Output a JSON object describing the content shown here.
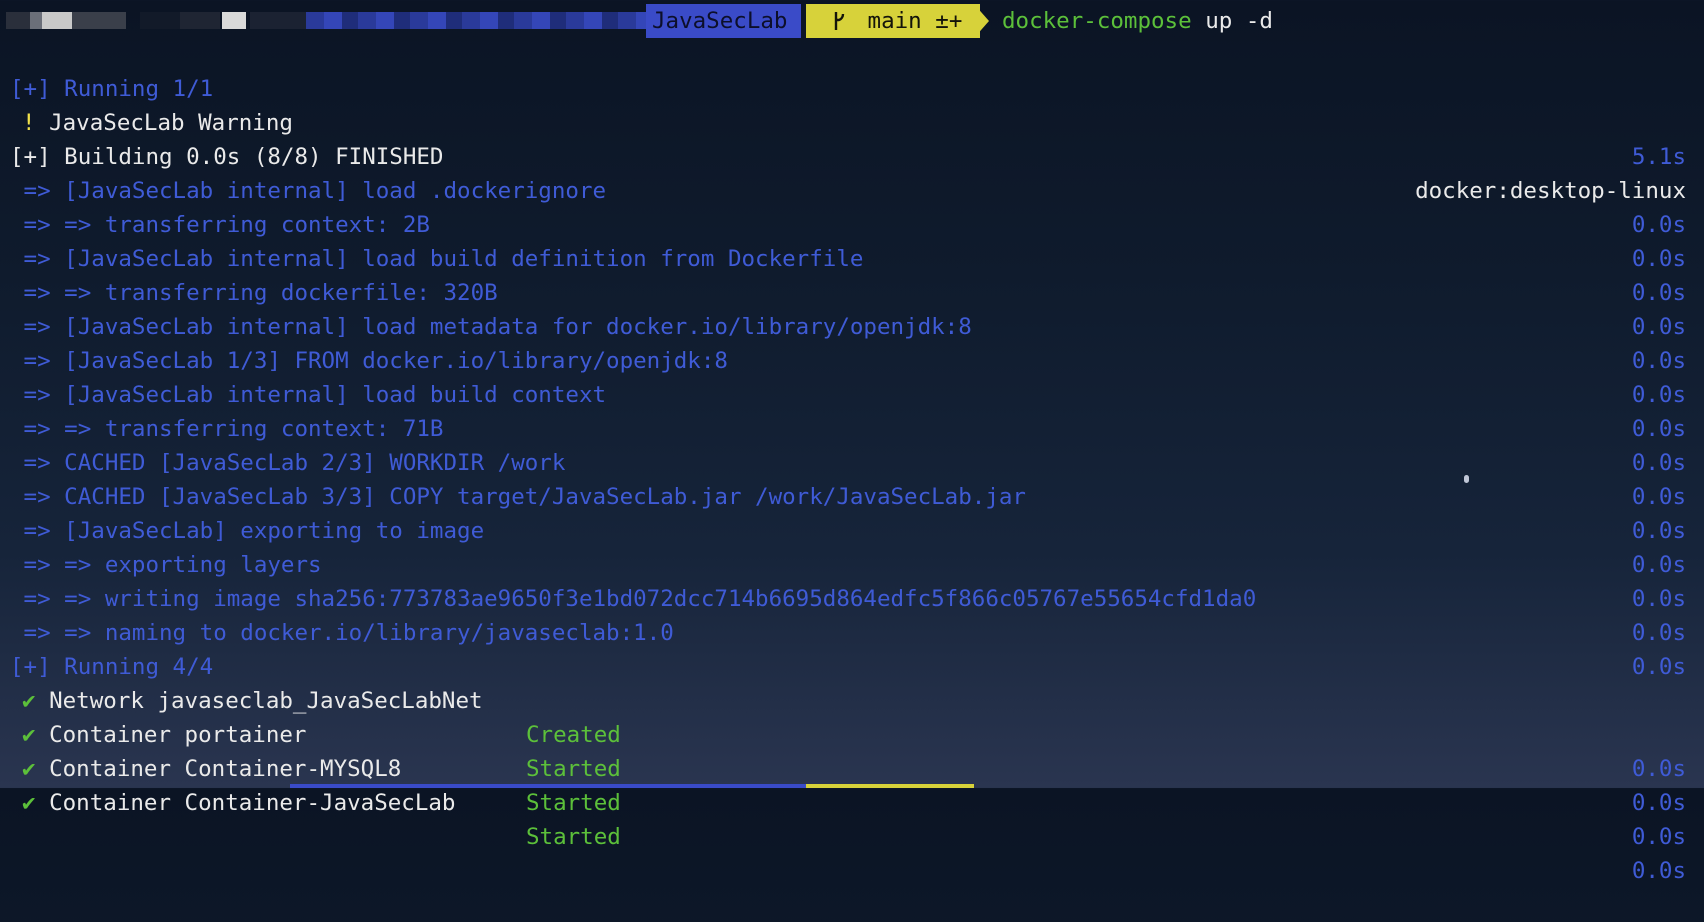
{
  "prompt": {
    "dir": "JavaSecLab",
    "branch_icon": "git-branch-icon",
    "branch": "main ±+",
    "command": "docker-compose",
    "args": " up -d"
  },
  "lines": [
    {
      "left": "[+] Running 1/1",
      "right": ""
    },
    {
      "marker": "!",
      "left": " JavaSecLab Warning",
      "right": "5.1s"
    },
    {
      "left": "[+] Building 0.0s (8/8) FINISHED",
      "right": "docker:desktop-linux"
    },
    {
      "left": " => [JavaSecLab internal] load .dockerignore",
      "right": "0.0s"
    },
    {
      "left": " => => transferring context: 2B",
      "right": "0.0s"
    },
    {
      "left": " => [JavaSecLab internal] load build definition from Dockerfile",
      "right": "0.0s"
    },
    {
      "left": " => => transferring dockerfile: 320B",
      "right": "0.0s"
    },
    {
      "left": " => [JavaSecLab internal] load metadata for docker.io/library/openjdk:8",
      "right": "0.0s"
    },
    {
      "left": " => [JavaSecLab 1/3] FROM docker.io/library/openjdk:8",
      "right": "0.0s"
    },
    {
      "left": " => [JavaSecLab internal] load build context",
      "right": "0.0s"
    },
    {
      "left": " => => transferring context: 71B",
      "right": "0.0s"
    },
    {
      "left": " => CACHED [JavaSecLab 2/3] WORKDIR /work",
      "right": "0.0s"
    },
    {
      "left": " => CACHED [JavaSecLab 3/3] COPY target/JavaSecLab.jar /work/JavaSecLab.jar",
      "right": "0.0s"
    },
    {
      "left": " => [JavaSecLab] exporting to image",
      "right": "0.0s"
    },
    {
      "left": " => => exporting layers",
      "right": "0.0s"
    },
    {
      "left": " => => writing image sha256:773783ae9650f3e1bd072dcc714b6695d864edfc5f866c05767e55654cfd1da0",
      "right": "0.0s"
    },
    {
      "left": " => => naming to docker.io/library/javaseclab:1.0",
      "right": "0.0s"
    },
    {
      "left": "[+] Running 4/4",
      "right": ""
    }
  ],
  "containers": [
    {
      "check": "✔",
      "name": "Network javaseclab_JavaSecLabNet",
      "status": "Created",
      "time": "0.0s"
    },
    {
      "check": "✔",
      "name": "Container portainer",
      "status": "Started",
      "time": "0.0s"
    },
    {
      "check": "✔",
      "name": "Container Container-MYSQL8",
      "status": "Started",
      "time": "0.0s"
    },
    {
      "check": "✔",
      "name": "Container Container-JavaSecLab",
      "status": "Started",
      "time": "0.0s"
    }
  ]
}
